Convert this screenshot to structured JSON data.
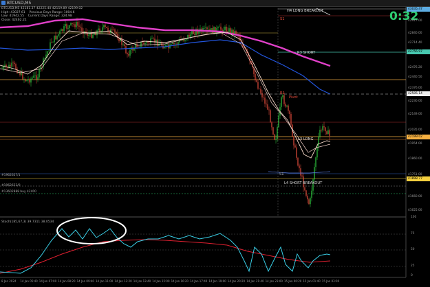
{
  "window": {
    "title": "BTCUSD,M5"
  },
  "info_panel": {
    "line1": "BTCUSD,M5 42181.37 42225.40 42159.89 42199.02",
    "line2": "High: 43027.61    Previous Days Range: 1004.6",
    "line3": "Low: 41942.55    Current Days Range: 324.98",
    "line4": "Close: 42462.21"
  },
  "timer": "0:32",
  "annotations": {
    "h4_long": "H4 LONG BREAKOUT",
    "r3_short": "R3 SHORT",
    "l3_long": "L3 LONG",
    "l4_short": "L4 SHORT BREAKOUT",
    "s1_top": "S1",
    "r1": "R1",
    "pivot": "Pivot",
    "s1_bottom": "S1",
    "line_a": "#1962627/1",
    "line_b": "#1962622/0",
    "line_c": "#13602888 buy 42400"
  },
  "price_scale": [
    {
      "label": "43015.00"
    },
    {
      "label": "42917.00"
    },
    {
      "label": "42840.00"
    },
    {
      "label": "42714.40"
    },
    {
      "label": "42590.40"
    },
    {
      "label": "42476.20"
    },
    {
      "label": "42440.50"
    },
    {
      "label": "42376.00"
    },
    {
      "label": "42230.00"
    },
    {
      "label": "42149.00"
    },
    {
      "label": "42035.00"
    },
    {
      "label": "41954.00"
    },
    {
      "label": "41860.00"
    },
    {
      "label": "41751.00"
    },
    {
      "label": "41660.00"
    },
    {
      "label": "41625.00"
    }
  ],
  "price_tags": [
    {
      "label": "43035.47",
      "color": "#5dade2"
    },
    {
      "label": "42756.97",
      "color": "#48c9b0"
    },
    {
      "label": "42505.14",
      "color": "#eeeeee"
    },
    {
      "label": "42199.02",
      "color": "#f5b041"
    },
    {
      "label": "41898.77",
      "color": "#f4d03f"
    }
  ],
  "oscillator": {
    "label": "Stoch(185,67,3) 39.7311 38.0534",
    "levels": [
      "100",
      "75",
      "50",
      "25",
      "0"
    ]
  },
  "time_axis": [
    "8 Jan 2024",
    "14 Jan 05:40",
    "14 Jan 07:00",
    "14 Jan 08:20",
    "14 Jan 09:40",
    "14 Jan 11:00",
    "14 Jan 12:20",
    "14 Jan 13:40",
    "14 Jan 15:00",
    "14 Jan 16:20",
    "14 Jan 17:40",
    "14 Jan 19:00",
    "14 Jan 20:20",
    "14 Jan 21:40",
    "14 Jan 23:00",
    "15 Jan 00:20",
    "15 Jan 01:40",
    "15 Jan 03:00"
  ],
  "colors": {
    "bull_candle": "#2ecc40",
    "bear_candle": "#e74c3c",
    "ma_slow": "#e040c8",
    "ma_mid": "#2255dd",
    "ma_fast": "#f3d6c6",
    "stoch_k": "#3ad0e8",
    "stoch_d": "#e02030"
  }
}
